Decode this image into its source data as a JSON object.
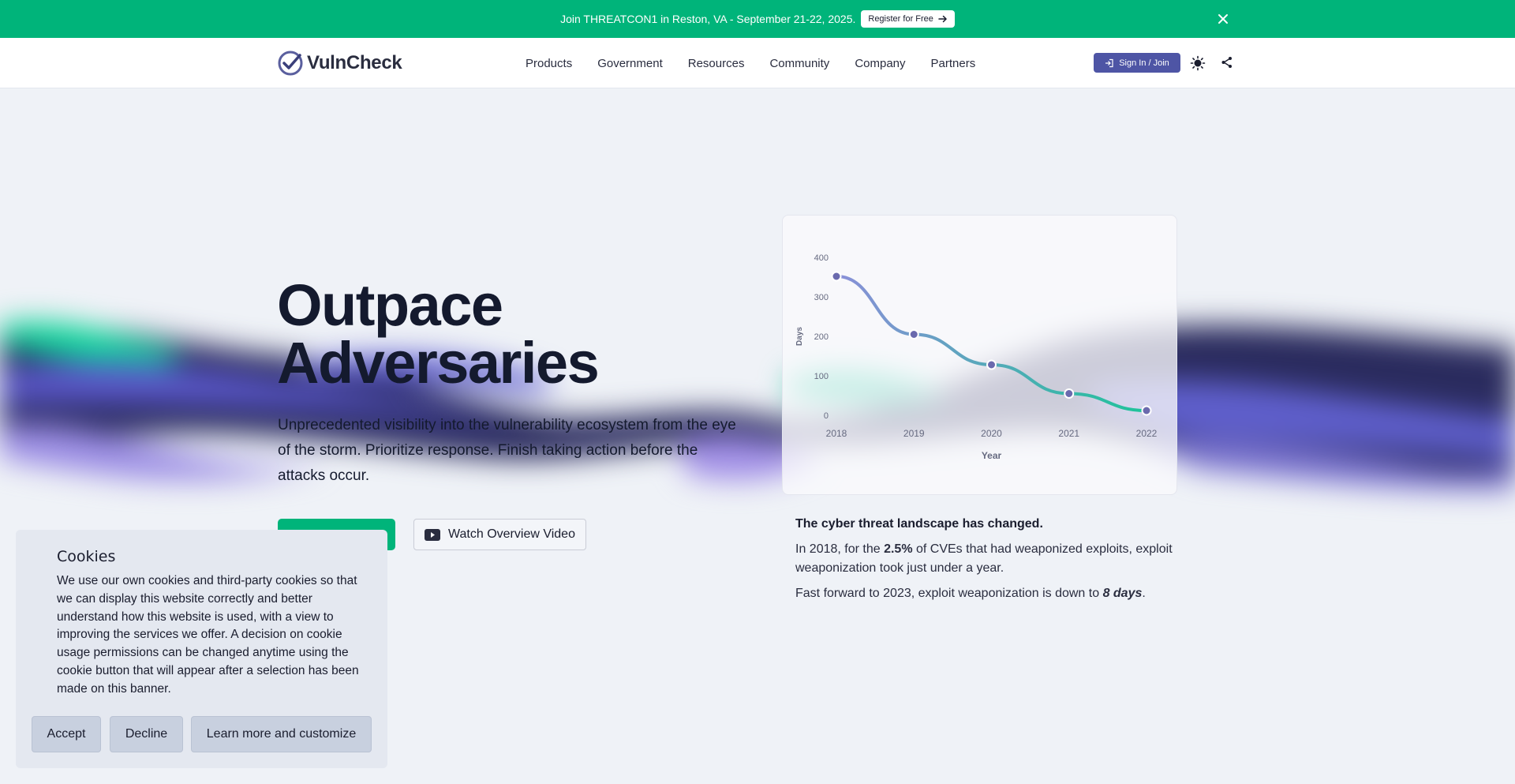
{
  "banner": {
    "text": "Join THREATCON1 in Reston, VA - September 21-22, 2025.",
    "button_label": "Register for Free",
    "background": "#00b47a"
  },
  "header": {
    "logo_text": "VulnCheck",
    "nav": [
      "Products",
      "Government",
      "Resources",
      "Community",
      "Company",
      "Partners"
    ],
    "signin_label": "Sign In / Join",
    "accent": "#4e55a5"
  },
  "hero": {
    "title_line1": "Outpace",
    "title_line2": "Adversaries",
    "subtitle": "Unprecedented visibility into the vulnerability ecosystem from the eye of the storm. Prioritize response. Finish taking action before the attacks occur.",
    "primary_cta_label": "",
    "video_cta_label": "Watch Overview Video"
  },
  "chart_data": {
    "type": "line",
    "x": [
      "2018",
      "2019",
      "2020",
      "2021",
      "2022"
    ],
    "values": [
      352,
      205,
      128,
      55,
      12
    ],
    "xlabel": "Year",
    "ylabel": "Days",
    "ylim": [
      0,
      400
    ],
    "yticks": [
      "0",
      "100",
      "200",
      "300",
      "400"
    ],
    "grid": false,
    "legend": "none",
    "colors": {
      "start": "#8a8fd8",
      "end": "#1ec49a",
      "marker": "#6b6aae"
    }
  },
  "caption": {
    "heading": "The cyber threat landscape has changed.",
    "line1_pre": "In 2018, for the ",
    "line1_bold": "2.5%",
    "line1_post": " of CVEs that had weaponized exploits, exploit weaponization took just under a year.",
    "line2_pre": "Fast forward to 2023, exploit weaponization is down to ",
    "line2_emph": "8 days",
    "line2_post": "."
  },
  "cookie": {
    "title": "Cookies",
    "body": "We use our own cookies and third-party cookies so that we can display this website correctly and better understand how this website is used, with a view to improving the services we offer. A decision on cookie usage permissions can be changed anytime using the cookie button that will appear after a selection has been made on this banner.",
    "accept_label": "Accept",
    "decline_label": "Decline",
    "customize_label": "Learn more and customize"
  },
  "icons": [
    "arrow-right-icon",
    "close-icon",
    "vulncheck-logo-icon",
    "sign-in-icon",
    "sun-icon",
    "share-icon",
    "play-icon"
  ]
}
